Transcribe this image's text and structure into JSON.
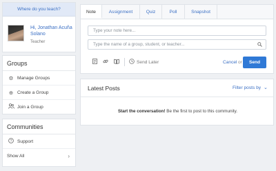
{
  "sidebar": {
    "where_prompt": "Where do you teach?",
    "profile": {
      "name": "Hi, Jonathan Acuña Solano",
      "role": "Teacher"
    },
    "groups": {
      "title": "Groups",
      "items": [
        {
          "label": "Manage Groups",
          "icon": "gear-icon"
        },
        {
          "label": "Create a Group",
          "icon": "plus-circle-icon"
        },
        {
          "label": "Join a Group",
          "icon": "users-icon"
        }
      ]
    },
    "communities": {
      "title": "Communities",
      "items": [
        {
          "label": "Support",
          "icon": "question-circle-icon"
        },
        {
          "label": "Show All",
          "icon": "chevron-right-icon"
        }
      ]
    }
  },
  "composer": {
    "tabs": [
      "Note",
      "Assignment",
      "Quiz",
      "Poll",
      "Snapshot"
    ],
    "active_tab": "Note",
    "note_placeholder": "Type your note here...",
    "recipient_placeholder": "Type the name of a group, student, or teacher...",
    "send_later_label": "Send Later",
    "cancel_label": "Cancel",
    "or_label": "or",
    "send_label": "Send"
  },
  "posts": {
    "title": "Latest Posts",
    "filter_label": "Filter posts by",
    "empty_bold": "Start the conversation!",
    "empty_rest": " Be the first to post to this community."
  },
  "colors": {
    "accent": "#2f79d6",
    "link": "#3a6fc4",
    "background": "#eef0f3"
  }
}
